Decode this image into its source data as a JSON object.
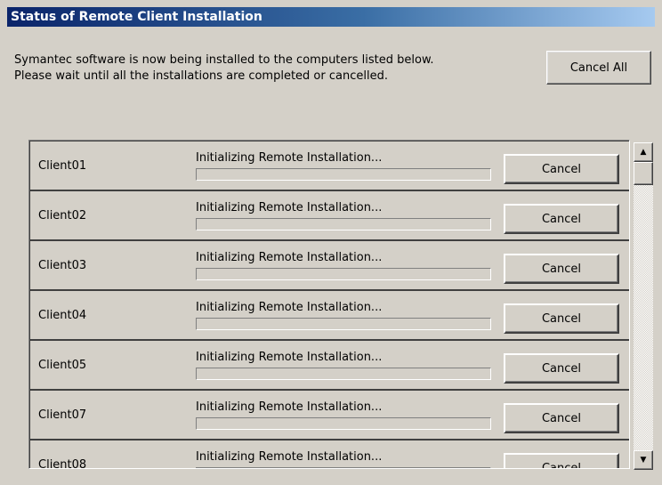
{
  "window": {
    "title": "Status of Remote Client Installation"
  },
  "message": {
    "text": "Symantec software is now being installed to the computers listed below.\nPlease wait until all the installations are completed or cancelled."
  },
  "toolbar": {
    "cancel_all_label": "Cancel All"
  },
  "clients": [
    {
      "name": "Client01",
      "status": "Initializing Remote Installation...",
      "progress": 0,
      "cancel_label": "Cancel"
    },
    {
      "name": "Client02",
      "status": "Initializing Remote Installation...",
      "progress": 0,
      "cancel_label": "Cancel"
    },
    {
      "name": "Client03",
      "status": "Initializing Remote Installation...",
      "progress": 0,
      "cancel_label": "Cancel"
    },
    {
      "name": "Client04",
      "status": "Initializing Remote Installation...",
      "progress": 0,
      "cancel_label": "Cancel"
    },
    {
      "name": "Client05",
      "status": "Initializing Remote Installation...",
      "progress": 0,
      "cancel_label": "Cancel"
    },
    {
      "name": "Client07",
      "status": "Initializing Remote Installation...",
      "progress": 0,
      "cancel_label": "Cancel"
    },
    {
      "name": "Client08",
      "status": "Initializing Remote Installation...",
      "progress": 0,
      "cancel_label": "Cancel"
    }
  ],
  "scrollbar": {
    "up_icon": "scroll-up-arrow",
    "down_icon": "scroll-down-arrow",
    "up_glyph": "▲",
    "down_glyph": "▼"
  },
  "colors": {
    "titlebar_start": "#0a246a",
    "titlebar_end": "#a6caf0",
    "window_background": "#d4d0c8",
    "progress_fill": "#0a246a"
  }
}
